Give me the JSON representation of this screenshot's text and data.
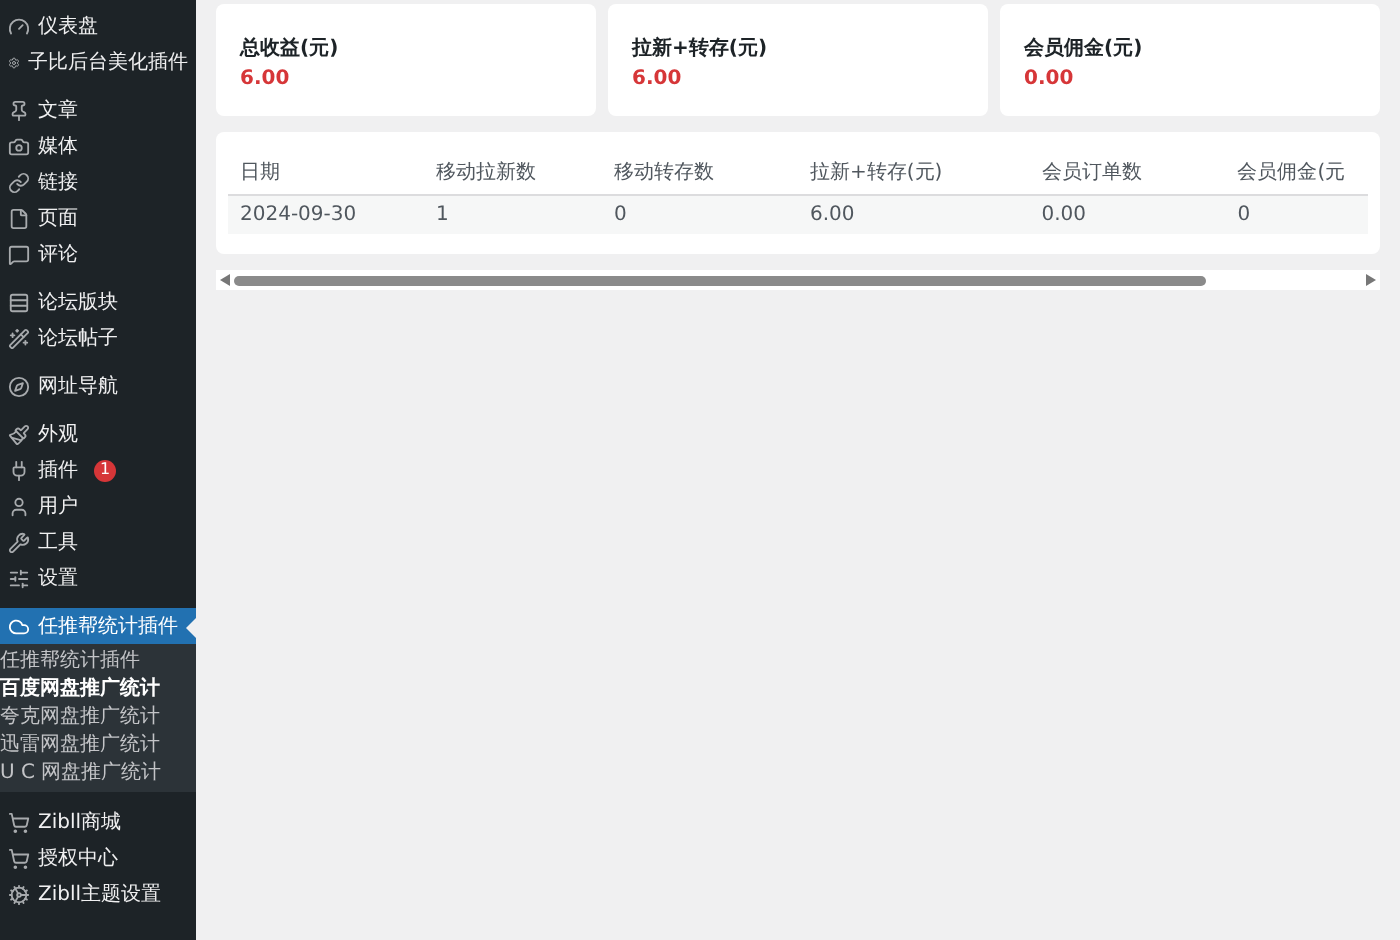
{
  "sidebar": {
    "items": [
      {
        "label": "仪表盘",
        "selected": false
      },
      {
        "label": "子比后台美化插件",
        "selected": false
      },
      {
        "label": "文章",
        "selected": false
      },
      {
        "label": "媒体",
        "selected": false
      },
      {
        "label": "链接",
        "selected": false
      },
      {
        "label": "页面",
        "selected": false
      },
      {
        "label": "评论",
        "selected": false
      },
      {
        "label": "论坛版块",
        "selected": false
      },
      {
        "label": "论坛帖子",
        "selected": false
      },
      {
        "label": "网址导航",
        "selected": false
      },
      {
        "label": "外观",
        "selected": false
      },
      {
        "label": "插件",
        "selected": false,
        "badge": "1"
      },
      {
        "label": "用户",
        "selected": false
      },
      {
        "label": "工具",
        "selected": false
      },
      {
        "label": "设置",
        "selected": false
      },
      {
        "label": "任推帮统计插件",
        "selected": true,
        "children": [
          {
            "label": "任推帮统计插件",
            "selected": false
          },
          {
            "label": "百度网盘推广统计",
            "selected": true
          },
          {
            "label": "夸克网盘推广统计",
            "selected": false
          },
          {
            "label": "迅雷网盘推广统计",
            "selected": false
          },
          {
            "label": "U C 网盘推广统计",
            "selected": false
          }
        ]
      },
      {
        "label": "Zibll商城",
        "selected": false
      },
      {
        "label": "授权中心",
        "selected": false
      },
      {
        "label": "Zibll主题设置",
        "selected": false
      }
    ]
  },
  "stats": [
    {
      "title": "总收益(元)",
      "value": "6.00"
    },
    {
      "title": "拉新+转存(元)",
      "value": "6.00"
    },
    {
      "title": "会员佣金(元)",
      "value": "0.00"
    }
  ],
  "table": {
    "columns": [
      "日期",
      "移动拉新数",
      "移动转存数",
      "拉新+转存(元)",
      "会员订单数",
      "会员佣金(元"
    ],
    "rows": [
      [
        "2024-09-30",
        "1",
        "0",
        "6.00",
        "0.00",
        "0"
      ]
    ]
  }
}
